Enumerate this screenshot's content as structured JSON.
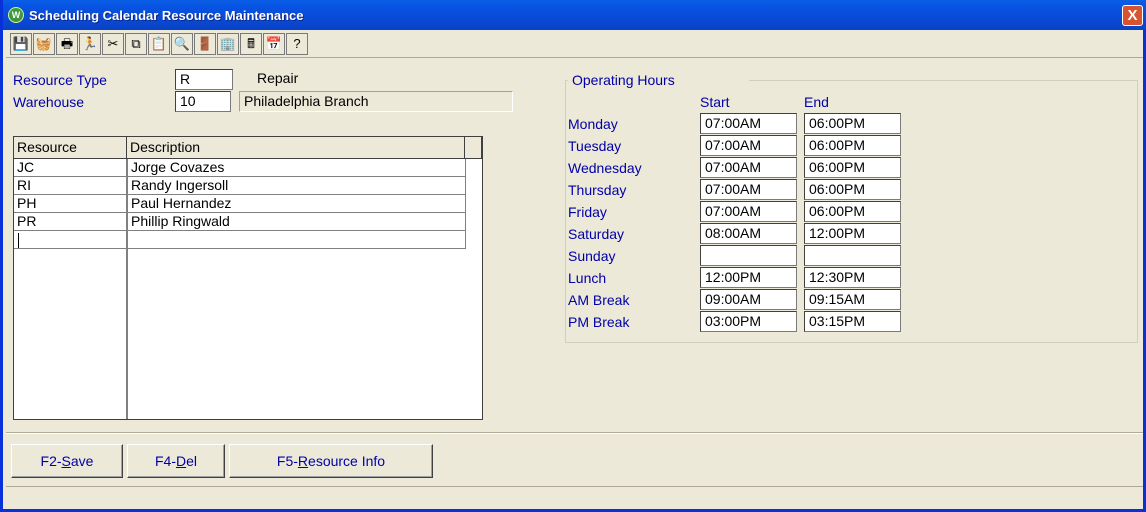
{
  "window": {
    "title": "Scheduling Calendar Resource Maintenance",
    "close_glyph": "X",
    "app_icon_glyph": "W"
  },
  "toolbar": {
    "buttons": [
      {
        "name": "save-icon",
        "glyph": "💾"
      },
      {
        "name": "basket-icon",
        "glyph": "🧺"
      },
      {
        "name": "print-icon",
        "glyph": "🖶"
      },
      {
        "name": "run-icon",
        "glyph": "🏃"
      },
      {
        "name": "cut-icon",
        "glyph": "✂"
      },
      {
        "name": "copy-icon",
        "glyph": "⧉"
      },
      {
        "name": "paste-icon",
        "glyph": "📋"
      },
      {
        "name": "search-icon",
        "glyph": "🔍"
      },
      {
        "name": "exit-door-icon",
        "glyph": "🚪"
      },
      {
        "name": "building-icon",
        "glyph": "🏢"
      },
      {
        "name": "calculator-icon",
        "glyph": "🖩"
      },
      {
        "name": "calendar-icon",
        "glyph": "📅"
      },
      {
        "name": "help-icon",
        "glyph": "?"
      }
    ]
  },
  "header": {
    "resource_type_label": "Resource Type",
    "resource_type_value": "R",
    "resource_type_desc": "Repair",
    "warehouse_label": "Warehouse",
    "warehouse_value": "10",
    "warehouse_desc": "Philadelphia Branch"
  },
  "grid": {
    "columns": [
      "Resource",
      "Description"
    ],
    "rows": [
      {
        "resource": "JC",
        "description": "Jorge Covazes"
      },
      {
        "resource": "RI",
        "description": "Randy Ingersoll"
      },
      {
        "resource": "PH",
        "description": "Paul Hernandez"
      },
      {
        "resource": "PR",
        "description": "Phillip Ringwald"
      },
      {
        "resource": "",
        "description": ""
      }
    ]
  },
  "operating_hours": {
    "title": "Operating Hours",
    "start_header": "Start",
    "end_header": "End",
    "days": [
      {
        "label": "Monday",
        "start": "07:00AM",
        "end": "06:00PM"
      },
      {
        "label": "Tuesday",
        "start": "07:00AM",
        "end": "06:00PM"
      },
      {
        "label": "Wednesday",
        "start": "07:00AM",
        "end": "06:00PM"
      },
      {
        "label": "Thursday",
        "start": "07:00AM",
        "end": "06:00PM"
      },
      {
        "label": "Friday",
        "start": "07:00AM",
        "end": "06:00PM"
      },
      {
        "label": "Saturday",
        "start": "08:00AM",
        "end": "12:00PM"
      },
      {
        "label": "Sunday",
        "start": "",
        "end": ""
      },
      {
        "label": "Lunch",
        "start": "12:00PM",
        "end": "12:30PM"
      },
      {
        "label": "AM Break",
        "start": "09:00AM",
        "end": "09:15AM"
      },
      {
        "label": "PM Break",
        "start": "03:00PM",
        "end": "03:15PM"
      }
    ]
  },
  "footer": {
    "save": {
      "prefix": "F2-",
      "hot": "S",
      "rest": "ave"
    },
    "del": {
      "prefix": "F4-",
      "hot": "D",
      "rest": "el"
    },
    "info": {
      "prefix": "F5-",
      "hot": "R",
      "rest": "esource Info"
    }
  }
}
